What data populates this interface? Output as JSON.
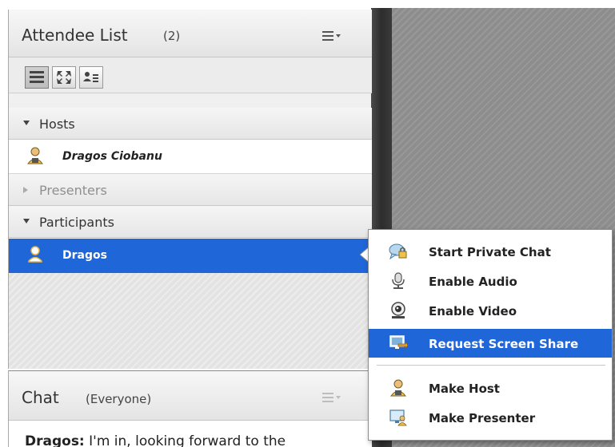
{
  "attendee_pod": {
    "title": "Attendee List",
    "count": "(2)",
    "menu_icon": "pod-options-icon",
    "view_modes": [
      {
        "icon": "list-view-icon",
        "active": true
      },
      {
        "icon": "expand-view-icon",
        "active": false
      },
      {
        "icon": "attendee-status-view-icon",
        "active": false
      }
    ],
    "sections": {
      "hosts": {
        "label": "Hosts",
        "expanded": true,
        "members": [
          "Dragos Ciobanu"
        ]
      },
      "presenters": {
        "label": "Presenters",
        "expanded": false
      },
      "participants": {
        "label": "Participants",
        "expanded": true,
        "members": [
          "Dragos"
        ]
      }
    },
    "selected_attendee": "Dragos"
  },
  "chat_pod": {
    "title": "Chat",
    "scope": "(Everyone)",
    "message": {
      "sender": "Dragos:",
      "text": " I'm in, looking forward to the"
    }
  },
  "context_menu": {
    "items": [
      {
        "label": "Start Private Chat",
        "icon": "private-chat-icon",
        "highlighted": false
      },
      {
        "label": "Enable Audio",
        "icon": "microphone-icon",
        "highlighted": false
      },
      {
        "label": "Enable Video",
        "icon": "webcam-icon",
        "highlighted": false
      },
      {
        "label": "Request Screen Share",
        "icon": "screen-share-icon",
        "highlighted": true
      },
      {
        "label": "Make Host",
        "icon": "host-icon",
        "highlighted": false
      },
      {
        "label": "Make Presenter",
        "icon": "presenter-icon",
        "highlighted": false
      }
    ]
  },
  "colors": {
    "selection": "#1f66d8",
    "content_area": "#8d8d8d",
    "divider": "#333333"
  }
}
